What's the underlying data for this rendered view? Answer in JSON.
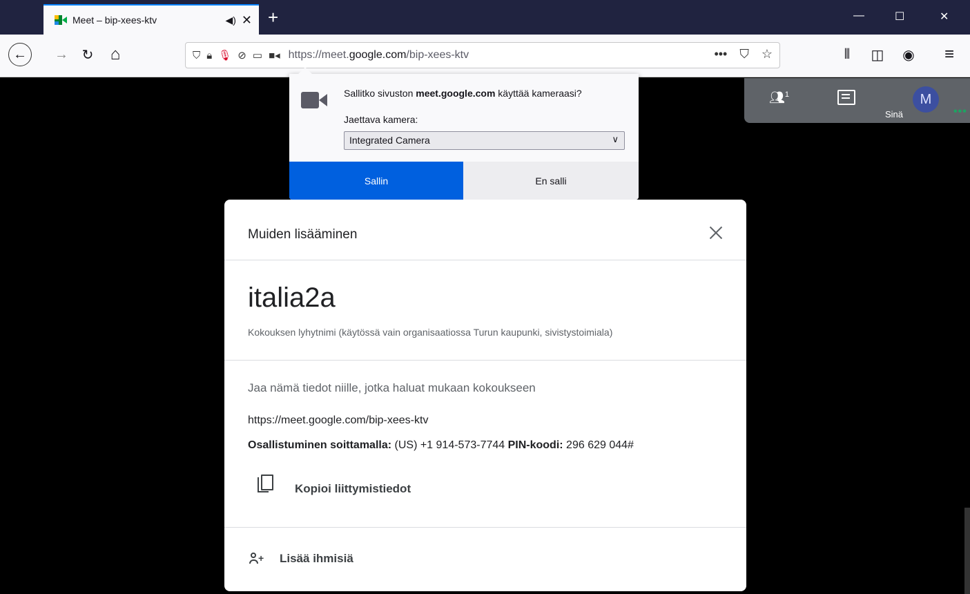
{
  "browser": {
    "tab": {
      "title": "Meet – bip-xees-ktv",
      "audio_icon": "speaker-icon",
      "close_glyph": "✕"
    },
    "new_tab_glyph": "+",
    "window_controls": {
      "minimize": "—",
      "maximize": "☐",
      "close": "✕"
    },
    "nav": {
      "back_glyph": "←",
      "forward_glyph": "→",
      "reload_glyph": "↻",
      "home_glyph": "⌂",
      "url_prefix": "https://meet.",
      "url_domain": "google.com",
      "url_path": "/bip-xees-ktv",
      "page_actions_glyph": "•••",
      "pocket_glyph": "⛉",
      "bookmark_glyph": "☆",
      "library_glyph": "⫴",
      "sidebar_glyph": "◫",
      "account_glyph": "◉",
      "menu_glyph": "≡"
    }
  },
  "permission_popup": {
    "question_prefix": "Sallitko sivuston ",
    "question_site": "meet.google.com",
    "question_suffix": " käyttää kameraasi?",
    "camera_label": "Jaettava kamera:",
    "camera_selected": "Integrated Camera",
    "allow_label": "Sallin",
    "deny_label": "En salli"
  },
  "meet_panel": {
    "participant_count": "1",
    "user_initial": "M",
    "user_label": "Sinä",
    "more_glyph": "•••"
  },
  "dialog": {
    "title": "Muiden lisääminen",
    "meeting_name": "italia2a",
    "meeting_desc": "Kokouksen lyhytnimi (käytössä vain organisaatiossa Turun kaupunki, sivistystoimiala)",
    "share_hint": "Jaa nämä tiedot niille, jotka haluat mukaan kokoukseen",
    "meet_link": "https://meet.google.com/bip-xees-ktv",
    "dial_label": "Osallistuminen soittamalla:",
    "dial_number": " (US) +1 914-573-7744  ",
    "pin_label": "PIN-koodi:",
    "pin_value": " 296 629 044#",
    "copy_label": "Kopioi liittymistiedot",
    "add_people_label": "Lisää ihmisiä"
  },
  "colors": {
    "tabbar": "#202340",
    "accent": "#0060df",
    "meet_panel": "#5f6368",
    "avatar": "#3c4fa0"
  }
}
